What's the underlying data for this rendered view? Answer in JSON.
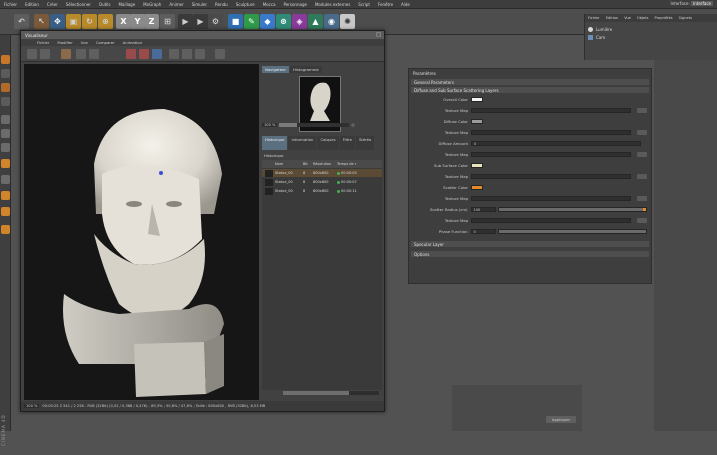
{
  "app": {
    "menu": [
      "Fichier",
      "Edition",
      "Créer",
      "Sélectionner",
      "Outils",
      "Maillage",
      "MoGraph",
      "Animer",
      "Simuler",
      "Rendu",
      "Sculpture",
      "Mocca",
      "Personnage",
      "Modules externes",
      "Script",
      "Fenêtre",
      "Aide"
    ],
    "interface_label": "Interface:",
    "interface_value": "Interface"
  },
  "toolbar": {
    "axis_x": "X",
    "axis_y": "Y",
    "axis_z": "Z"
  },
  "left_vertical_text": "CINEMA 4D",
  "object_manager": {
    "menu": [
      "Fichier",
      "Edition",
      "Vue",
      "Objets",
      "Propriétés",
      "Signets"
    ],
    "objects": [
      "Lumière",
      "Cam"
    ]
  },
  "viewer": {
    "title": "Visualiseur",
    "menu": [
      "Fichier",
      "Modifier",
      "Vue",
      "Comparer",
      "Animation"
    ],
    "nav_tabs": [
      "Navigateur",
      "Histogramme"
    ],
    "zoom_value": "100 %",
    "hist_tabs": [
      "Historique",
      "Information",
      "Calques",
      "Filtre",
      "Stéréo"
    ],
    "history_title": "Historique",
    "columns": [
      "Nom",
      "Bit",
      "Résolution",
      "Temps de r"
    ],
    "rows": [
      {
        "name": "Statue_00",
        "bit": "8",
        "res": "800x800",
        "time": "00:00:05"
      },
      {
        "name": "Statue_00",
        "bit": "8",
        "res": "800x800",
        "time": "00:00:07"
      },
      {
        "name": "Statue_00",
        "bit": "8",
        "res": "800x800",
        "time": "00:00:11"
      }
    ],
    "status_zoom": "100 %",
    "status_text": "00:00:25   2 541 / 2 258 - RVB (32Bit) (0,52 / 0,388 / 0,476) - 89,3% ; 50,8% / 47,6% ; Taille : 800x800 , RVB (32Bit), 8,53 MB"
  },
  "attributes": {
    "title": "Paramètres",
    "sections": [
      "General Parameters",
      "Diffuse and Sub Surface Scattering Layers",
      "Specular Layer",
      "Options"
    ],
    "rows": [
      {
        "label": "Overall Color",
        "kind": "color",
        "color": "#f2f2f2"
      },
      {
        "label": "Texture Map",
        "kind": "map"
      },
      {
        "label": "Diffuse Color",
        "kind": "color",
        "color": "#9a9a9a"
      },
      {
        "label": "Texture Map",
        "kind": "map"
      },
      {
        "label": "Diffuse Amount",
        "kind": "num",
        "value": "0"
      },
      {
        "label": "Texture Map",
        "kind": "map"
      },
      {
        "label": "Sub Surface Color",
        "kind": "color",
        "color": "#e9e2b8"
      },
      {
        "label": "Texture Map",
        "kind": "map"
      },
      {
        "label": "Scatter Color",
        "kind": "color",
        "color": "#e48a2c"
      },
      {
        "label": "Texture Map",
        "kind": "map"
      },
      {
        "label": "Scatter Radius (cm)",
        "kind": "slider",
        "value": "100"
      },
      {
        "label": "Texture Map",
        "kind": "map"
      },
      {
        "label": "Phase Function",
        "kind": "slider",
        "value": "0"
      }
    ]
  },
  "coord_apply": "Appliquer",
  "colors": {
    "accent": "#5a6f80",
    "orange": "#e48a2c",
    "green_dot": "#3fb24f"
  }
}
